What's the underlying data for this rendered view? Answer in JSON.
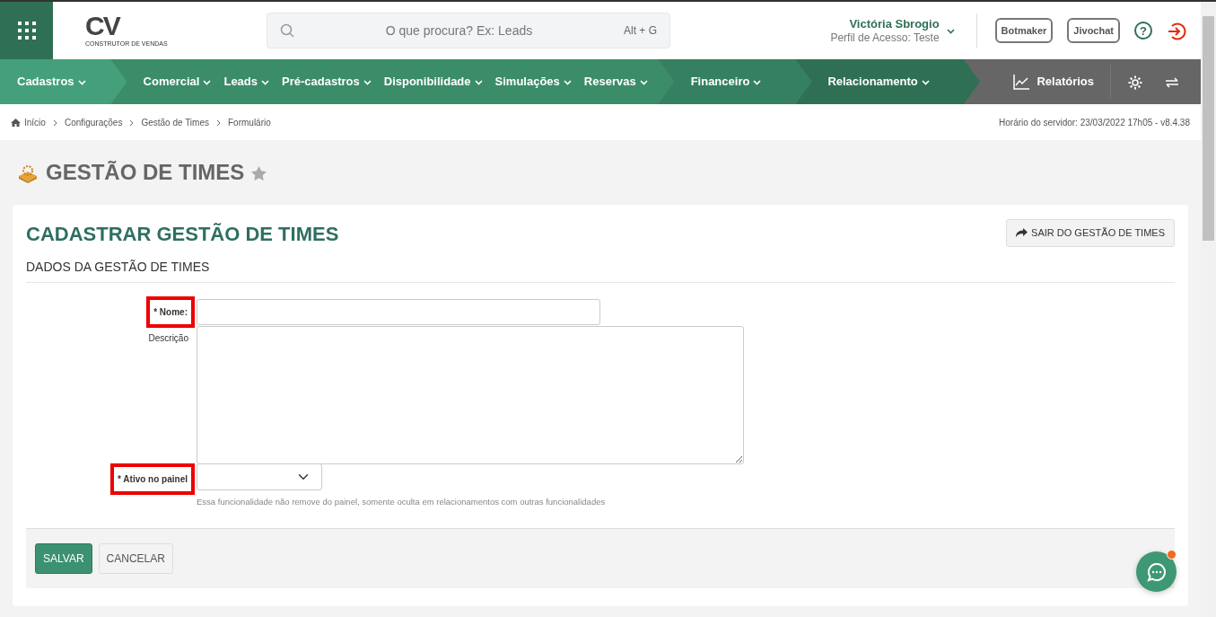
{
  "header": {
    "logo": {
      "mark": "CV",
      "tagline": "CONSTRUTOR DE VENDAS"
    },
    "search": {
      "placeholder": "O que procura? Ex: Leads",
      "shortcut": "Alt + G"
    },
    "user": {
      "name": "Victória Sbrogio",
      "profile": "Perfil de Acesso: Teste"
    },
    "buttons": [
      "Botmaker",
      "Jivochat"
    ],
    "help": "?"
  },
  "menu": [
    {
      "color": "#43a07a",
      "items": [
        "Cadastros"
      ]
    },
    {
      "color": "#3b8c69",
      "items": [
        "Comercial",
        "Leads",
        "Pré-cadastros",
        "Disponibilidade",
        "Simulações",
        "Reservas"
      ]
    },
    {
      "color": "#358060",
      "items": [
        "Financeiro"
      ]
    },
    {
      "color": "#2f7055",
      "items": [
        "Relacionamento"
      ]
    }
  ],
  "reports": "Relatórios",
  "breadcrumb": [
    "Início",
    "Configurações",
    "Gestão de Times",
    "Formulário"
  ],
  "server_time": "Horário do servidor: 23/03/2022 17h05 - v8.4.38",
  "page_title": "GESTÃO DE TIMES",
  "favorite": false,
  "form": {
    "title": "CADASTRAR GESTÃO DE TIMES",
    "exit_button": "SAIR DO GESTÃO DE TIMES",
    "section": "DADOS DA GESTÃO DE TIMES",
    "fields": [
      {
        "kind": "text",
        "label": "* Nome:",
        "required": true,
        "highlighted": true
      },
      {
        "kind": "textarea",
        "label": "Descrição",
        "required": false,
        "highlighted": false
      },
      {
        "kind": "select",
        "label": "* Ativo no painel",
        "required": true,
        "highlighted": true,
        "help": "Essa funcionalidade não remove do painel, somente oculta em relacionamentos com outras funcionalidades"
      }
    ],
    "actions": [
      {
        "kind": "primary",
        "label": "SALVAR"
      },
      {
        "kind": "secondary",
        "label": "CANCELAR"
      }
    ]
  },
  "chat": {
    "unread": true
  }
}
